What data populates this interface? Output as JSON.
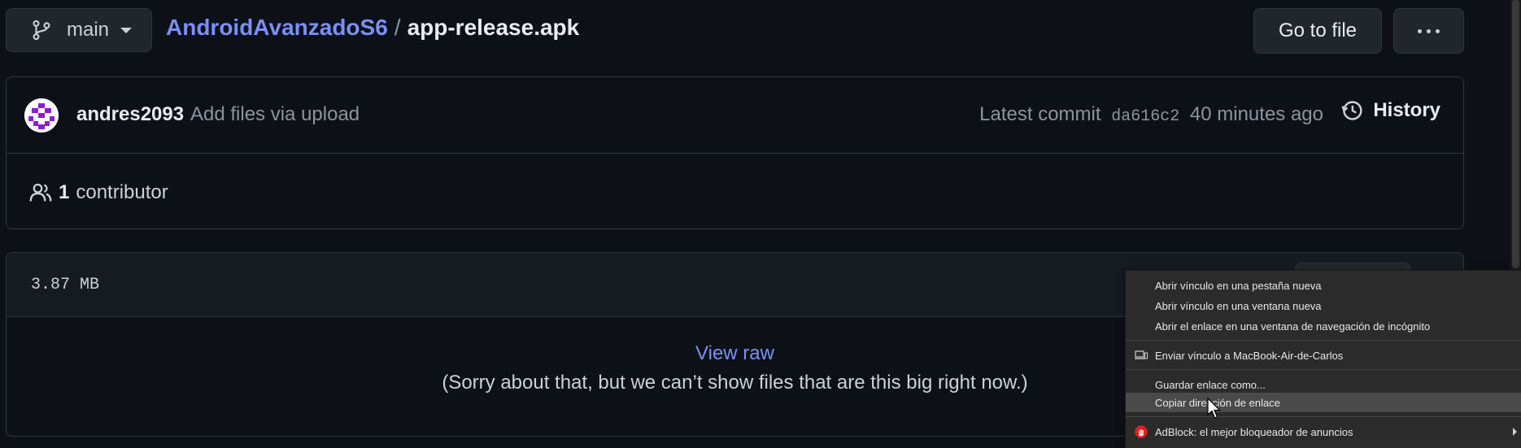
{
  "branch": {
    "name": "main",
    "icon": "git-branch-icon"
  },
  "breadcrumb": {
    "repo": "AndroidAvanzadoS6",
    "separator": "/",
    "file": "app-release.apk"
  },
  "toolbar": {
    "go_to_file_label": "Go to file",
    "more_icon": "kebab-horizontal-icon"
  },
  "commit": {
    "author": "andres2093",
    "message": "Add files via upload",
    "latest_commit_label": "Latest commit",
    "sha": "da616c2",
    "time": "40 minutes ago",
    "history_label": "History"
  },
  "contributors": {
    "count": "1",
    "label": "contributor"
  },
  "file": {
    "size": "3.87 MB",
    "view_raw_label": "View raw",
    "too_big_message": "(Sorry about that, but we can’t show files that are this big right now.)"
  },
  "context_menu": {
    "items": [
      {
        "label": "Abrir vínculo en una pestaña nueva"
      },
      {
        "label": "Abrir vínculo en una ventana nueva"
      },
      {
        "label": "Abrir el enlace en una ventana de navegación de incógnito"
      },
      {
        "label": "Enviar vínculo a MacBook-Air-de-Carlos",
        "icon": "device-send-icon"
      },
      {
        "label": "Guardar enlace como..."
      },
      {
        "label": "Copiar dirección de enlace",
        "highlighted": true
      },
      {
        "label": "AdBlock: el mejor bloqueador de anuncios",
        "icon": "adblock-icon",
        "submenu": true
      }
    ]
  },
  "colors": {
    "background": "#0d1117",
    "link": "#7b8ff7",
    "border": "#30363d",
    "menu_bg": "#2b2b2b",
    "menu_highlight": "#4a4a4a",
    "adblock_red": "#e02020"
  }
}
